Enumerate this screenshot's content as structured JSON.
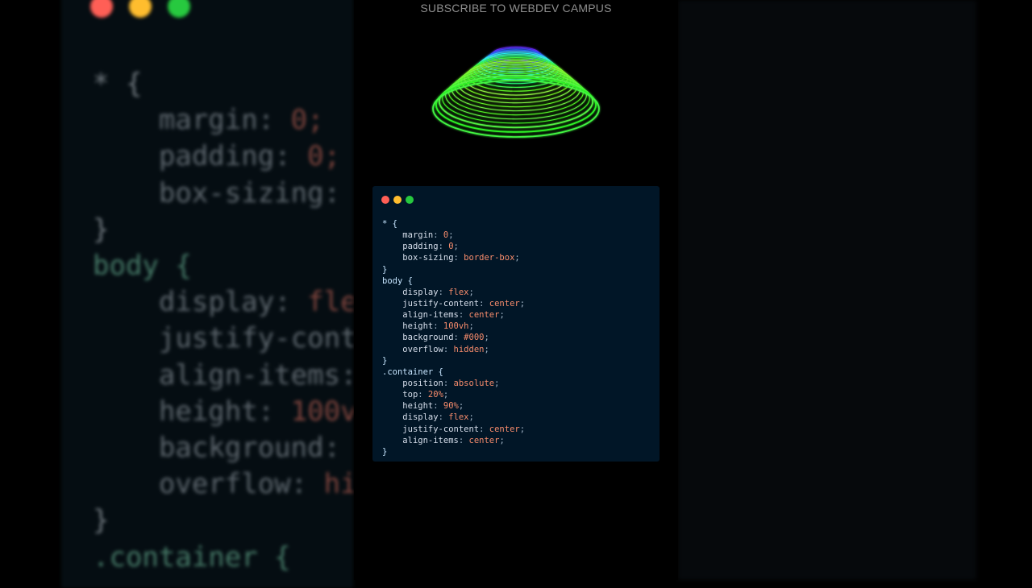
{
  "header": {
    "title": "SUBSCRIBE TO WEBDEV CAMPUS"
  },
  "window": {
    "controls": [
      {
        "name": "close",
        "color": "#ff5f56"
      },
      {
        "name": "minimize",
        "color": "#ffbd2e"
      },
      {
        "name": "maximize",
        "color": "#27c93f"
      }
    ]
  },
  "code": {
    "blocks": [
      {
        "selector": "* {",
        "rules": [
          {
            "prop": "margin",
            "value": "0"
          },
          {
            "prop": "padding",
            "value": "0"
          },
          {
            "prop": "box-sizing",
            "value": "border-box"
          }
        ],
        "close": "}"
      },
      {
        "selector": "body {",
        "rules": [
          {
            "prop": "display",
            "value": "flex"
          },
          {
            "prop": "justify-content",
            "value": "center"
          },
          {
            "prop": "align-items",
            "value": "center"
          },
          {
            "prop": "height",
            "value": "100vh"
          },
          {
            "prop": "background",
            "value": "#000"
          },
          {
            "prop": "overflow",
            "value": "hidden"
          }
        ],
        "close": "}"
      },
      {
        "selector": ".container {",
        "rules": [
          {
            "prop": "position",
            "value": "absolute"
          },
          {
            "prop": "top",
            "value": "20%"
          },
          {
            "prop": "height",
            "value": "90%"
          },
          {
            "prop": "display",
            "value": "flex"
          },
          {
            "prop": "justify-content",
            "value": "center"
          },
          {
            "prop": "align-items",
            "value": "center"
          }
        ],
        "close": "}"
      }
    ]
  },
  "background_code": {
    "lines": [
      {
        "sel": "* {"
      },
      {
        "prop": "margin",
        "value": "0;"
      },
      {
        "prop": "padding",
        "value": "0;"
      },
      {
        "prop": "box-sizing",
        "value": ""
      },
      {
        "sel": "}"
      },
      {
        "sel": "body {"
      },
      {
        "prop": "display",
        "value": "fle"
      },
      {
        "prop": "justify-cont",
        "value": ""
      },
      {
        "prop": "align-items",
        "value": ""
      },
      {
        "prop": "height",
        "value": "100v"
      },
      {
        "prop": "background",
        "value": ""
      },
      {
        "prop": "overflow",
        "value": "hi"
      },
      {
        "sel": "}"
      },
      {
        "sel": ".container {"
      }
    ]
  }
}
